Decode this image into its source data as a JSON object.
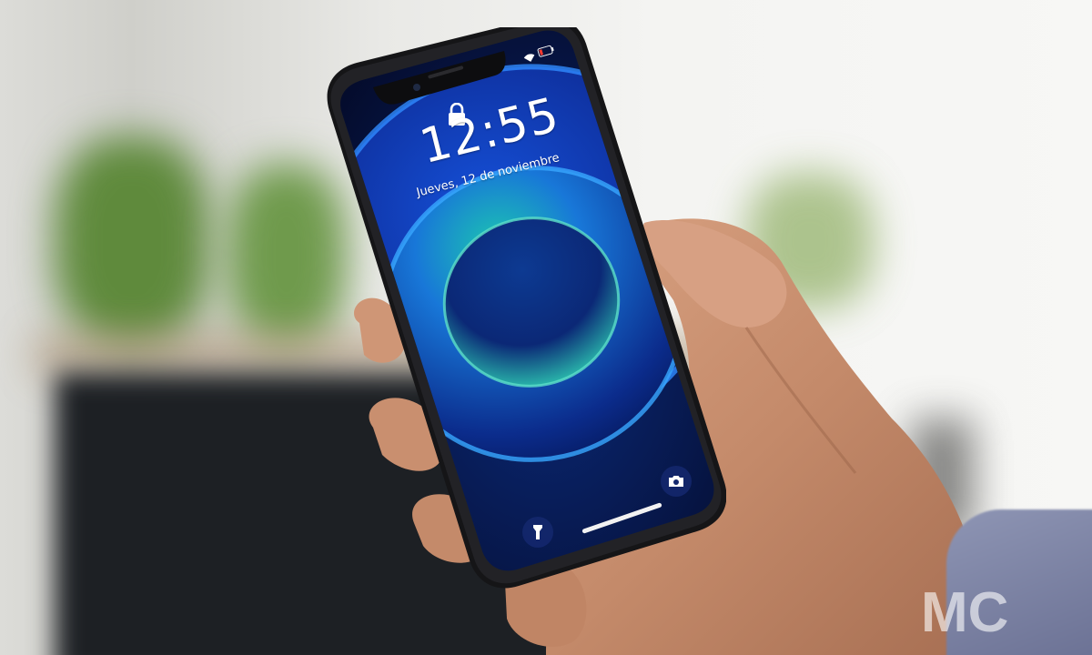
{
  "lock_screen": {
    "time": "12:55",
    "date": "Jueves, 12 de noviembre",
    "icons": {
      "lock": "lock-icon",
      "wifi": "wifi-icon",
      "battery": "battery-icon",
      "flashlight": "flashlight-icon",
      "camera": "camera-icon"
    }
  },
  "watermark": {
    "text": "MC"
  },
  "colors": {
    "wallpaper_dark": "#06103a",
    "wallpaper_blue": "#1e6cff",
    "wallpaper_teal": "#2ab7a8",
    "phone_frame": "#1a1a1c",
    "skin": "#c98f6f",
    "sleeve": "#7d84a6"
  }
}
